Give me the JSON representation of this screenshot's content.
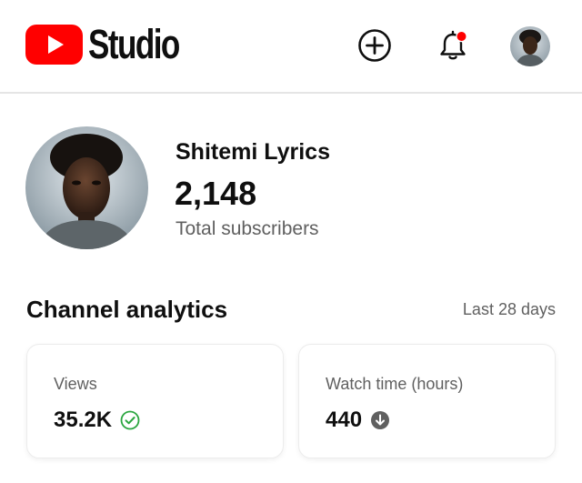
{
  "header": {
    "logo_text": "Studio",
    "brand_color": "#ff0000",
    "icons": [
      "youtube-logo-icon",
      "create-plus-icon",
      "notification-bell-icon",
      "account-avatar"
    ],
    "notification_dot_color": "#ff0000"
  },
  "channel": {
    "name": "Shitemi Lyrics",
    "subscriber_count": "2,148",
    "subscriber_label": "Total subscribers"
  },
  "analytics": {
    "title": "Channel analytics",
    "period": "Last 28 days",
    "cards": [
      {
        "label": "Views",
        "value": "35.2K",
        "status_icon": "check-circle-icon",
        "status_color": "#2ba640"
      },
      {
        "label": "Watch time (hours)",
        "value": "440",
        "status_icon": "arrow-down-circle-icon",
        "status_color": "#606060"
      }
    ]
  }
}
